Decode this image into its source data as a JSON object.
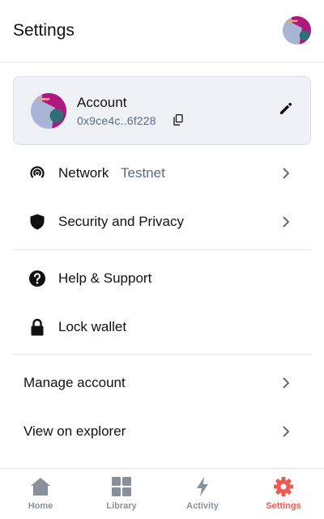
{
  "header": {
    "title": "Settings"
  },
  "account": {
    "name": "Account",
    "address": "0x9ce4c..6f228"
  },
  "menu": {
    "network": {
      "label": "Network",
      "value": "Testnet"
    },
    "security": {
      "label": "Security and Privacy"
    },
    "help": {
      "label": "Help & Support"
    },
    "lock": {
      "label": "Lock wallet"
    },
    "manage": {
      "label": "Manage account"
    },
    "explorer": {
      "label": "View on explorer"
    }
  },
  "tabs": [
    {
      "label": "Home",
      "icon": "home-icon"
    },
    {
      "label": "Library",
      "icon": "grid-icon"
    },
    {
      "label": "Activity",
      "icon": "lightning-icon"
    },
    {
      "label": "Settings",
      "icon": "gear-icon",
      "active": true
    }
  ],
  "colors": {
    "accent": "#ee5a4f",
    "muted": "#5b6b7e",
    "inactive_tab": "#8a9099",
    "card_bg": "#eef1f6"
  }
}
